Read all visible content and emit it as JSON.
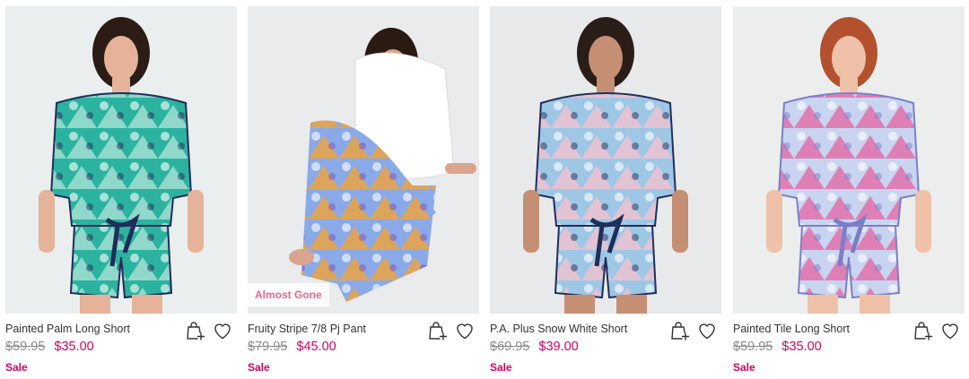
{
  "products": [
    {
      "name": "Painted Palm Long Short",
      "was_price": "$59.95",
      "now_price": "$35.00",
      "sale_label": "Sale",
      "badge": "",
      "image_colors": {
        "bg": "#ebeeee",
        "main": "#2bb3a0",
        "accent": "#a7e1d4",
        "trim": "#1f2d5a",
        "hair": "#2b1c16",
        "skin": "#e4b39a"
      }
    },
    {
      "name": "Fruity Stripe 7/8 Pj Pant",
      "was_price": "$79.95",
      "now_price": "$45.00",
      "sale_label": "Sale",
      "badge": "Almost Gone",
      "image_colors": {
        "bg": "#e9ebec",
        "main": "#8aa9e8",
        "accent": "#f1a23a",
        "trim": "#7a54b5",
        "hair": "#2a1a14",
        "skin": "#d9a58e"
      }
    },
    {
      "name": "P.A. Plus Snow White Short",
      "was_price": "$69.95",
      "now_price": "$39.00",
      "sale_label": "Sale",
      "badge": "",
      "image_colors": {
        "bg": "#e8e9ea",
        "main": "#9ec7e6",
        "accent": "#f2c2cf",
        "trim": "#1f2f5a",
        "hair": "#2a1d17",
        "skin": "#c58f74"
      }
    },
    {
      "name": "Painted Tile Long Short",
      "was_price": "$59.95",
      "now_price": "$35.00",
      "sale_label": "Sale",
      "badge": "",
      "image_colors": {
        "bg": "#eceeee",
        "main": "#c9d5f0",
        "accent": "#e46aa8",
        "trim": "#7c7fc7",
        "hair": "#b3502d",
        "skin": "#efc1a8"
      }
    }
  ],
  "colors": {
    "sale_pink": "#d6005f",
    "badge_pink": "#f0648c",
    "text": "#333333",
    "muted": "#8a8a8a"
  },
  "icons": {
    "add_to_bag": "bag-plus-icon",
    "wishlist": "heart-outline-icon"
  }
}
